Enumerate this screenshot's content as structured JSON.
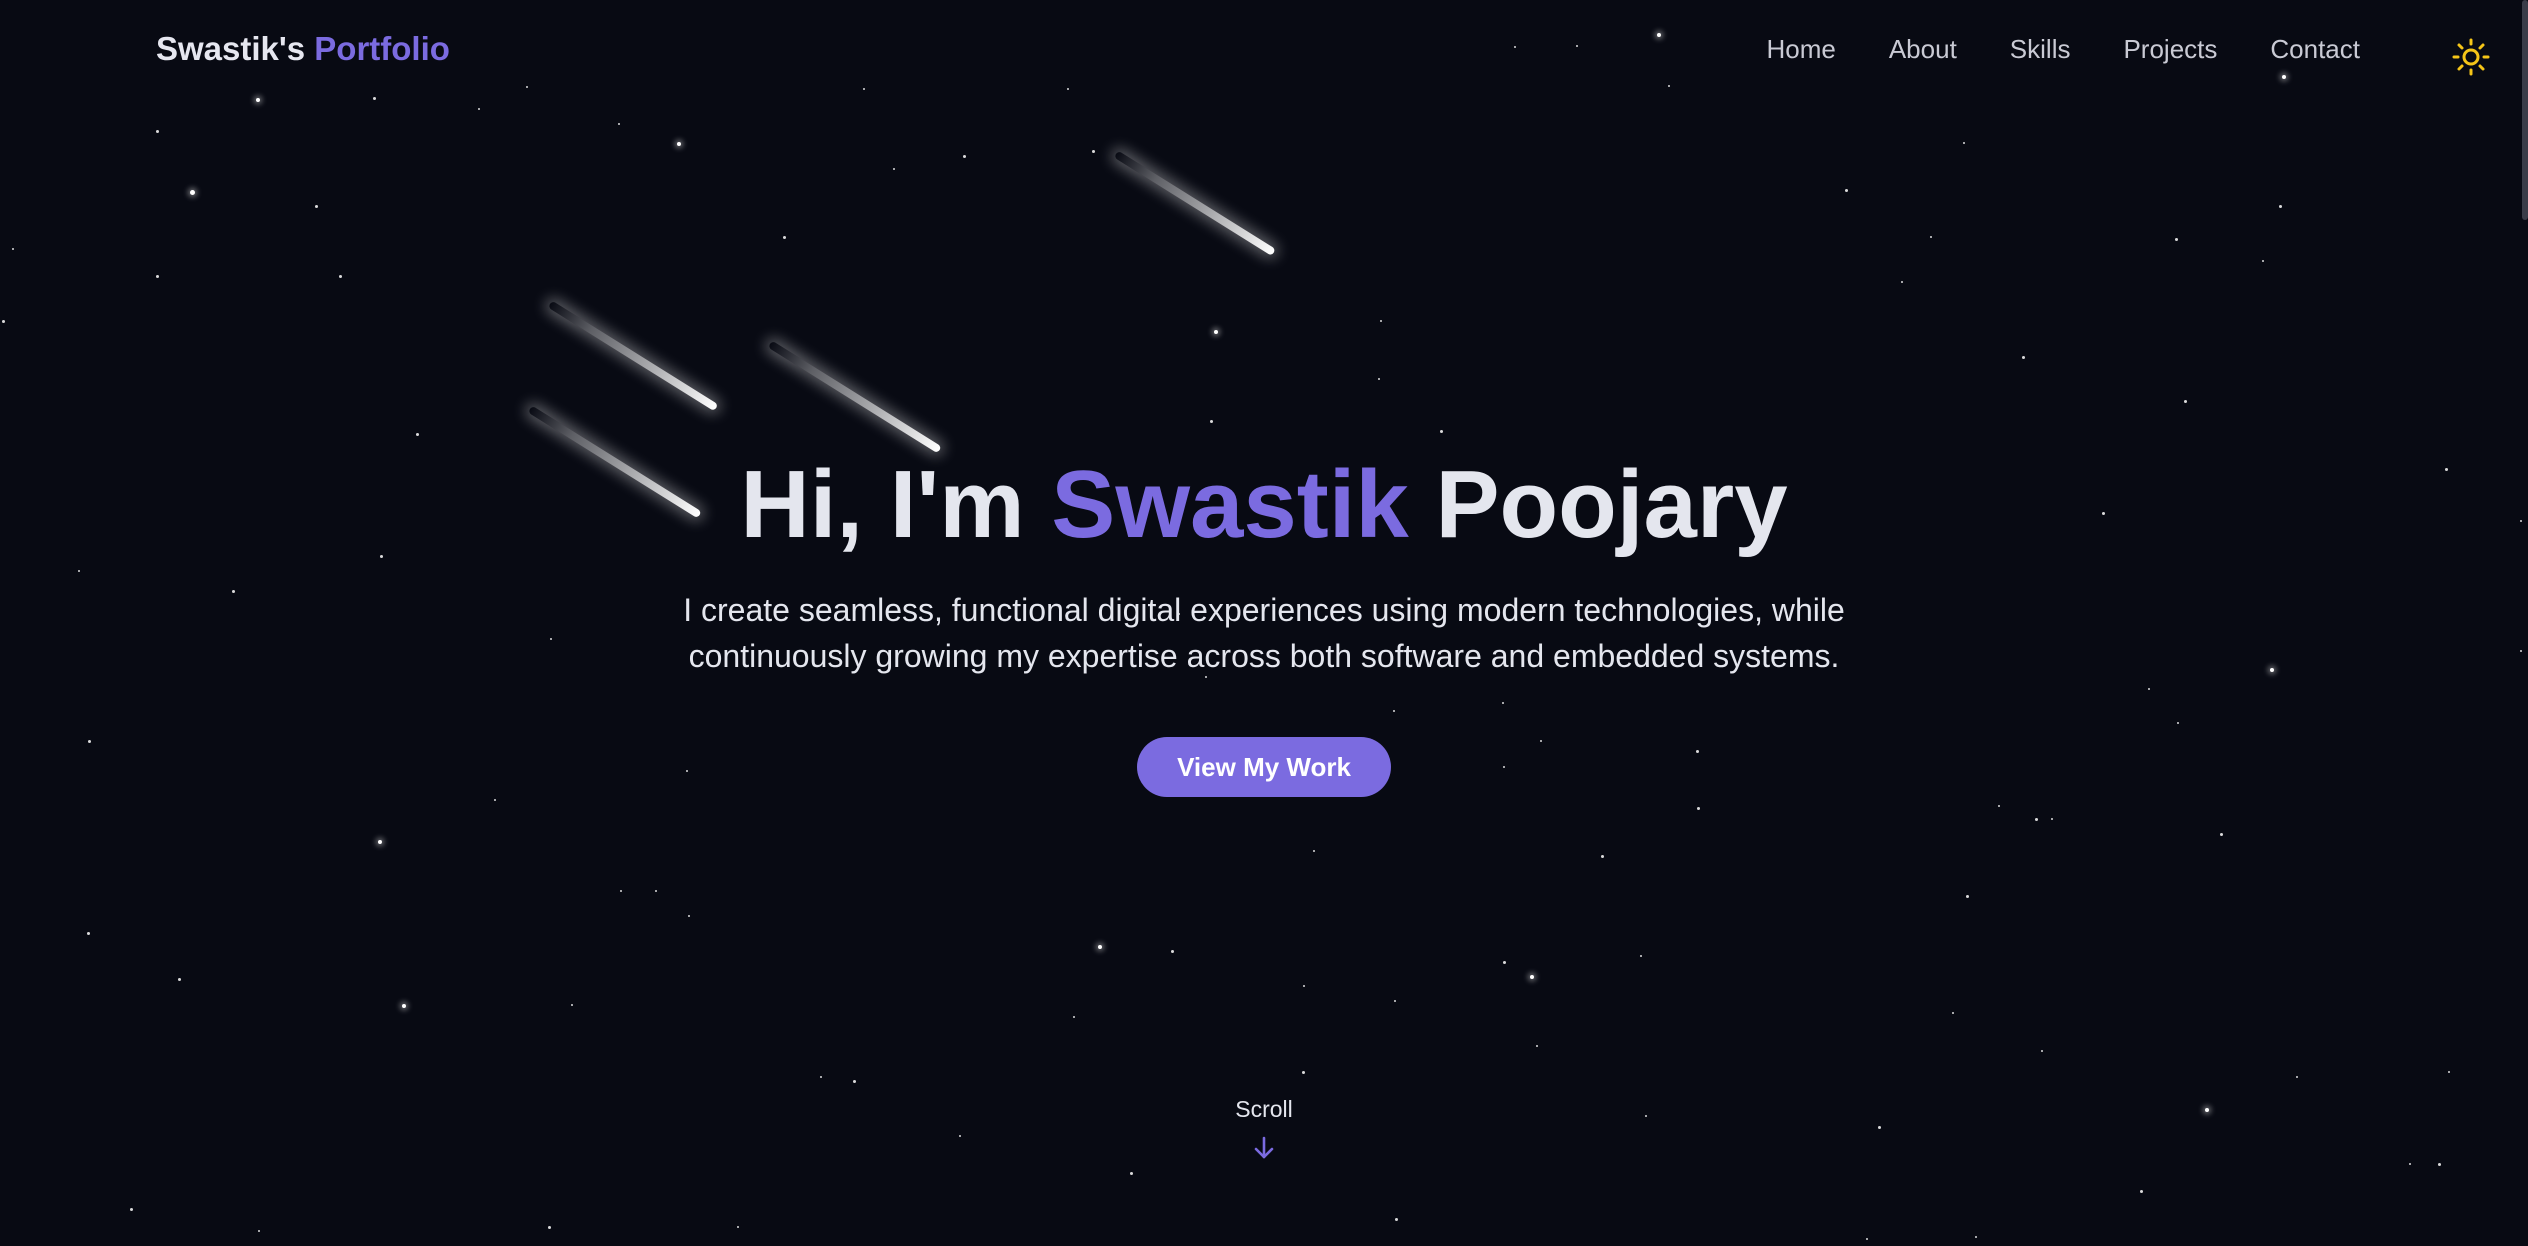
{
  "navbar": {
    "brand_name": "Swastik's",
    "brand_accent": "Portfolio",
    "links": [
      "Home",
      "About",
      "Skills",
      "Projects",
      "Contact"
    ],
    "theme_toggle_icon": "sun-icon"
  },
  "hero": {
    "title_prefix": "Hi, I'm",
    "title_accent": "Swastik",
    "title_suffix": "Poojary",
    "description": "I create seamless, functional digital experiences using modern technologies, while continuously growing my expertise across both software and embedded systems.",
    "cta_label": "View My Work"
  },
  "scroll": {
    "label": "Scroll",
    "icon": "arrow-down-icon"
  },
  "colors": {
    "background": "#080a13",
    "accent": "#7b6be0",
    "text": "#e4e6ee",
    "sun": "#f5c518"
  }
}
